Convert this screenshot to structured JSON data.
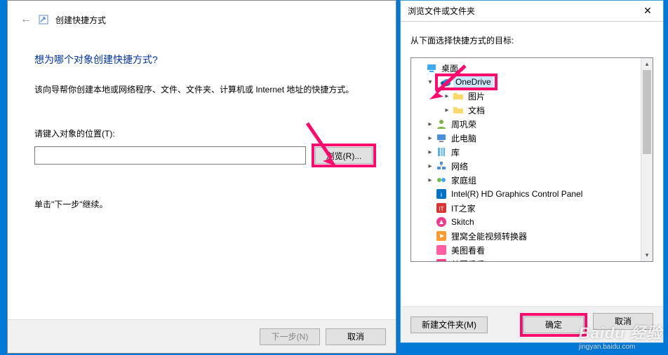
{
  "wizard": {
    "title": "创建快捷方式",
    "question": "想为哪个对象创建快捷方式?",
    "description": "该向导帮你创建本地或网络程序、文件、文件夹、计算机或 Internet 地址的快捷方式。",
    "field_label": "请键入对象的位置(T):",
    "path_value": "",
    "browse_label": "浏览(R)...",
    "continue_hint": "单击\"下一步\"继续。",
    "next_label": "下一步(N)",
    "cancel_label": "取消"
  },
  "browse": {
    "title": "浏览文件或文件夹",
    "instruction": "从下面选择快捷方式的目标:",
    "new_folder_label": "新建文件夹(M)",
    "ok_label": "确定",
    "cancel_label": "取消",
    "tree": [
      {
        "depth": 1,
        "exp": "",
        "icon": "desktop",
        "label": "桌面"
      },
      {
        "depth": 2,
        "exp": "▾",
        "icon": "onedrive",
        "label": "OneDrive",
        "highlighted": true,
        "selected": true
      },
      {
        "depth": 3,
        "exp": "▸",
        "icon": "folder",
        "label": "图片"
      },
      {
        "depth": 3,
        "exp": "▸",
        "icon": "folder",
        "label": "文档"
      },
      {
        "depth": 2,
        "exp": "▸",
        "icon": "user",
        "label": "周巩荣"
      },
      {
        "depth": 2,
        "exp": "▸",
        "icon": "thispc",
        "label": "此电脑"
      },
      {
        "depth": 2,
        "exp": "▸",
        "icon": "libraries",
        "label": "库"
      },
      {
        "depth": 2,
        "exp": "▸",
        "icon": "network",
        "label": "网络"
      },
      {
        "depth": 2,
        "exp": "▸",
        "icon": "homegroup",
        "label": "家庭组"
      },
      {
        "depth": 2,
        "exp": "",
        "icon": "intel",
        "label": "Intel(R) HD Graphics Control Panel"
      },
      {
        "depth": 2,
        "exp": "",
        "icon": "ithome",
        "label": "IT之家"
      },
      {
        "depth": 2,
        "exp": "",
        "icon": "skitch",
        "label": "Skitch"
      },
      {
        "depth": 2,
        "exp": "",
        "icon": "video",
        "label": "狸窝全能视频转换器"
      },
      {
        "depth": 2,
        "exp": "",
        "icon": "meitu",
        "label": "美图看看"
      },
      {
        "depth": 2,
        "exp": "",
        "icon": "meitu2",
        "label": "美图秀秀"
      }
    ]
  },
  "watermark": {
    "brand": "Baidu 经验",
    "url": "jingyan.baidu.com"
  }
}
